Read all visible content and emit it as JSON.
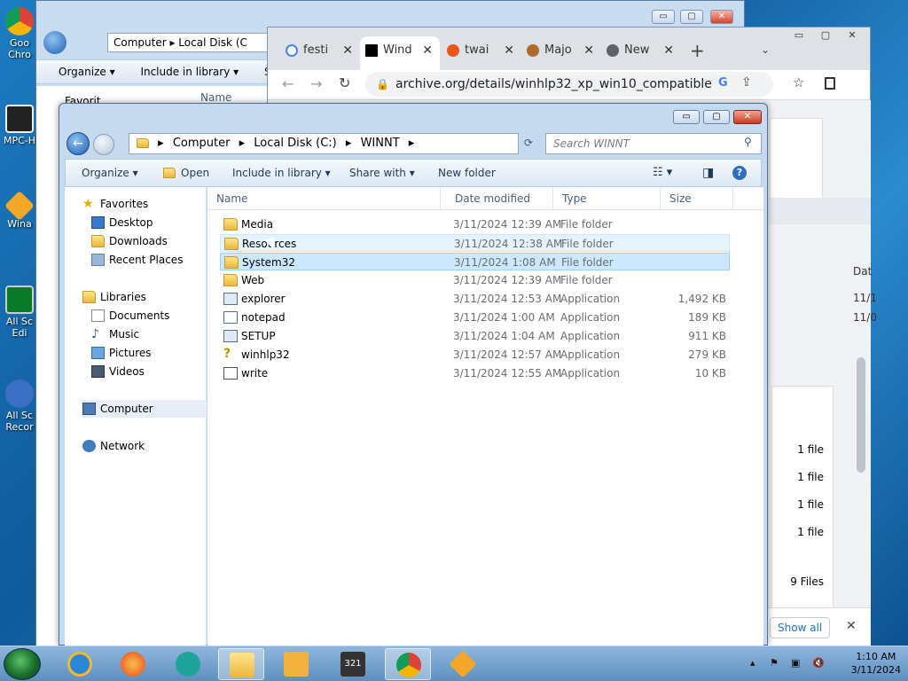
{
  "desktop_icons": [
    {
      "label": "Goo Chro"
    },
    {
      "label": "MPC-H"
    },
    {
      "label": "Wina"
    },
    {
      "label": "All Sc Edi"
    },
    {
      "label": "All Sc Recor"
    }
  ],
  "back_window": {
    "path": "Computer ▸ Local Disk (C",
    "toolbar": [
      "Organize ▾",
      "Include in library ▾",
      "Sh"
    ],
    "nav_partial": "Favorit",
    "col_name": "Name",
    "minimize": "▭",
    "maximize": "▢",
    "close": "✕"
  },
  "chrome": {
    "tabs": [
      {
        "label": "festi",
        "fav_color": "#4285f4"
      },
      {
        "label": "Wind",
        "fav_color": "#000000"
      },
      {
        "label": "twai",
        "fav_color": "#e8571a"
      },
      {
        "label": "Majo",
        "fav_color": "#b06a2a"
      },
      {
        "label": "New",
        "fav_color": "#5f6368"
      }
    ],
    "new_tab": "+",
    "url": "archive.org/details/winhlp32_xp_win10_compatible",
    "side_header": "Dat",
    "side_dates": [
      "11/1",
      "11/0"
    ],
    "side_counts": [
      "1 file",
      "1 file",
      "1 file",
      "1 file",
      "9 Files"
    ],
    "show_all": "Show all",
    "close_x": "✕"
  },
  "explorer": {
    "breadcrumb": [
      "Computer",
      "Local Disk (C:)",
      "WINNT"
    ],
    "search_placeholder": "Search WINNT",
    "toolbar": {
      "organize": "Organize ▾",
      "open": "Open",
      "include": "Include in library ▾",
      "share": "Share with ▾",
      "new_folder": "New folder"
    },
    "nav": {
      "favorites": "Favorites",
      "desktop": "Desktop",
      "downloads": "Downloads",
      "recent": "Recent Places",
      "libraries": "Libraries",
      "documents": "Documents",
      "music": "Music",
      "pictures": "Pictures",
      "videos": "Videos",
      "computer": "Computer",
      "network": "Network"
    },
    "columns": {
      "name": "Name",
      "date": "Date modified",
      "type": "Type",
      "size": "Size"
    },
    "files": [
      {
        "name": "Media",
        "date": "3/11/2024 12:39 AM",
        "type": "File folder",
        "size": ""
      },
      {
        "name": "Resources",
        "date": "3/11/2024 12:38 AM",
        "type": "File folder",
        "size": ""
      },
      {
        "name": "System32",
        "date": "3/11/2024 1:08 AM",
        "type": "File folder",
        "size": ""
      },
      {
        "name": "Web",
        "date": "3/11/2024 12:39 AM",
        "type": "File folder",
        "size": ""
      },
      {
        "name": "explorer",
        "date": "3/11/2024 12:53 AM",
        "type": "Application",
        "size": "1,492 KB"
      },
      {
        "name": "notepad",
        "date": "3/11/2024 1:00 AM",
        "type": "Application",
        "size": "189 KB"
      },
      {
        "name": "SETUP",
        "date": "3/11/2024 1:04 AM",
        "type": "Application",
        "size": "911 KB"
      },
      {
        "name": "winhlp32",
        "date": "3/11/2024 12:57 AM",
        "type": "Application",
        "size": "279 KB"
      },
      {
        "name": "write",
        "date": "3/11/2024 12:55 AM",
        "type": "Application",
        "size": "10 KB"
      }
    ]
  },
  "taskbar": {
    "time": "1:10 AM",
    "date": "3/11/2024",
    "badge_321": "321"
  }
}
